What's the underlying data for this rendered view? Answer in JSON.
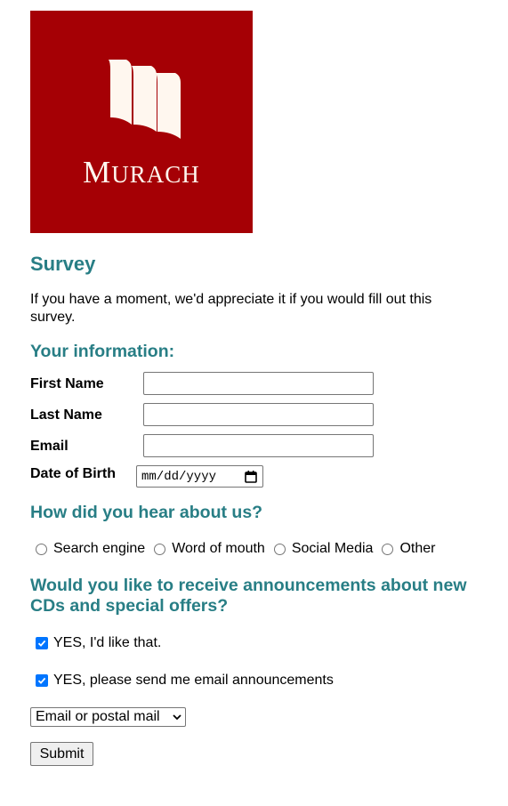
{
  "logo": {
    "text": "Murach",
    "background": "#a50005"
  },
  "page": {
    "title": "Survey",
    "intro": "If you have a moment, we'd appreciate it if you would fill out this survey."
  },
  "info": {
    "heading": "Your information:",
    "first_name_label": "First Name",
    "first_name_value": "",
    "last_name_label": "Last Name",
    "last_name_value": "",
    "email_label": "Email",
    "email_value": "",
    "dob_label": "Date of Birth",
    "dob_placeholder": "mm/dd/yyyy"
  },
  "hear": {
    "heading": "How did you hear about us?",
    "options": [
      "Search engine",
      "Word of mouth",
      "Social Media",
      "Other"
    ]
  },
  "announcements": {
    "heading": "Would you like to receive announcements about new CDs and special offers?",
    "check1_label": "YES, I'd like that.",
    "check1_checked": true,
    "check2_label": "YES, please send me email announcements",
    "check2_checked": true,
    "contact_select": "Email or postal mail"
  },
  "submit_label": "Submit",
  "colors": {
    "heading": "#287e85",
    "checkbox": "#0075ff"
  }
}
